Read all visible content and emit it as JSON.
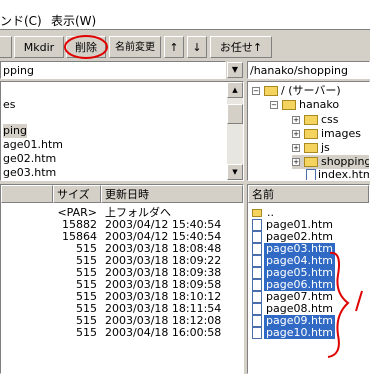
{
  "menu": {
    "items": [
      "ンド(C)",
      "表示(W)"
    ]
  },
  "toolbar": {
    "buttons": [
      "Mkdir",
      "削除",
      "名前変更",
      "↑",
      "↓",
      "お任せ↑"
    ]
  },
  "local_path": {
    "value": "pping"
  },
  "remote_path": {
    "value": "/hanako/shopping"
  },
  "local_tree": {
    "items": [
      "es",
      "ping",
      "age01.htm",
      "ge02.htm",
      "ge03.htm"
    ]
  },
  "remote_tree": {
    "root": "/ (サーバー)",
    "hanako": "hanako",
    "children": [
      "css",
      "images",
      "js",
      "shopping",
      "index.htm"
    ]
  },
  "local_list": {
    "headers": {
      "size": "サイズ",
      "date": "更新日時"
    },
    "rows": [
      {
        "size": "<PAR>",
        "date": "上フォルダへ"
      },
      {
        "size": "15882",
        "date": "2003/04/12 15:40:54"
      },
      {
        "size": "15864",
        "date": "2003/04/12 15:40:54"
      },
      {
        "size": "515",
        "date": "2003/03/18 18:08:48"
      },
      {
        "size": "515",
        "date": "2003/03/18 18:09:22"
      },
      {
        "size": "515",
        "date": "2003/03/18 18:09:38"
      },
      {
        "size": "515",
        "date": "2003/03/18 18:09:58"
      },
      {
        "size": "515",
        "date": "2003/03/18 18:10:12"
      },
      {
        "size": "515",
        "date": "2003/03/18 18:11:54"
      },
      {
        "size": "515",
        "date": "2003/03/18 18:12:08"
      },
      {
        "size": "515",
        "date": "2003/04/18 16:00:58"
      }
    ]
  },
  "remote_list": {
    "header": "名前",
    "rows": [
      {
        "name": "..",
        "selected": false
      },
      {
        "name": "page01.htm",
        "selected": false
      },
      {
        "name": "page02.htm",
        "selected": false
      },
      {
        "name": "page03.htm",
        "selected": true
      },
      {
        "name": "page04.htm",
        "selected": true
      },
      {
        "name": "page05.htm",
        "selected": true
      },
      {
        "name": "page06.htm",
        "selected": true
      },
      {
        "name": "page07.htm",
        "selected": false
      },
      {
        "name": "page08.htm",
        "selected": false
      },
      {
        "name": "page09.htm",
        "selected": true
      },
      {
        "name": "page10.htm",
        "selected": true
      }
    ]
  },
  "colors": {
    "selection": "#316ac5",
    "annotation": "#e00000",
    "chrome": "#d4d0c8"
  }
}
